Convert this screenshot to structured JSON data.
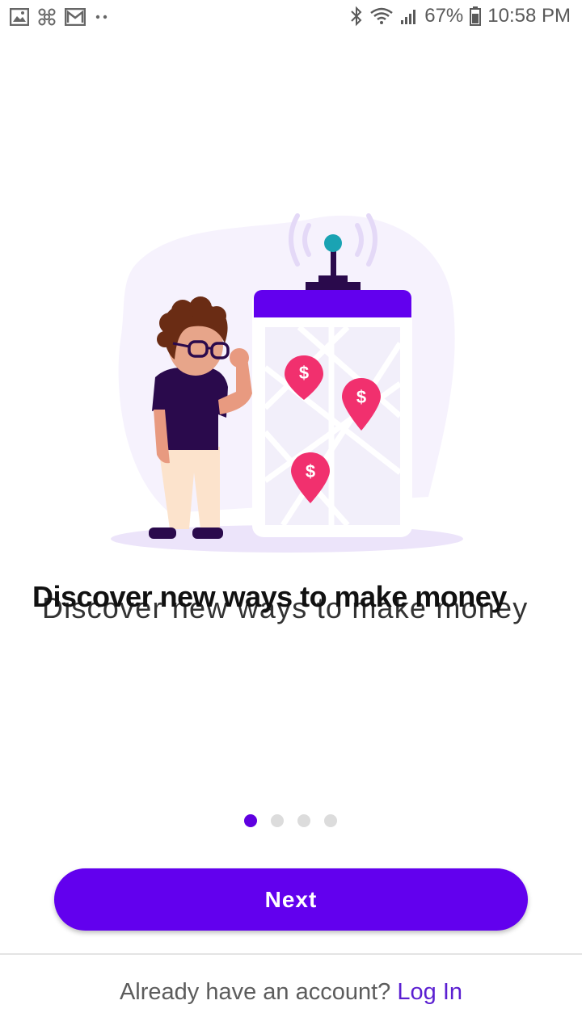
{
  "status_bar": {
    "battery_percent": "67%",
    "time": "10:58 PM",
    "notification_icons": [
      "image-icon",
      "fan-icon",
      "gmail-icon",
      "more-dots-icon"
    ],
    "system_icons": [
      "bluetooth-icon",
      "wifi-icon",
      "signal-icon",
      "battery-icon"
    ]
  },
  "onboarding": {
    "headline": "Discover new ways to make money",
    "page_indicator": {
      "current": 1,
      "total": 4
    },
    "illustration": "person-with-map-phone-illustration"
  },
  "actions": {
    "next_label": "Next"
  },
  "footer": {
    "prompt": "Already have an account?",
    "login_label": "Log In"
  },
  "colors": {
    "accent": "#6200ee",
    "pin": "#f1306e",
    "link": "#5b1fd1"
  }
}
